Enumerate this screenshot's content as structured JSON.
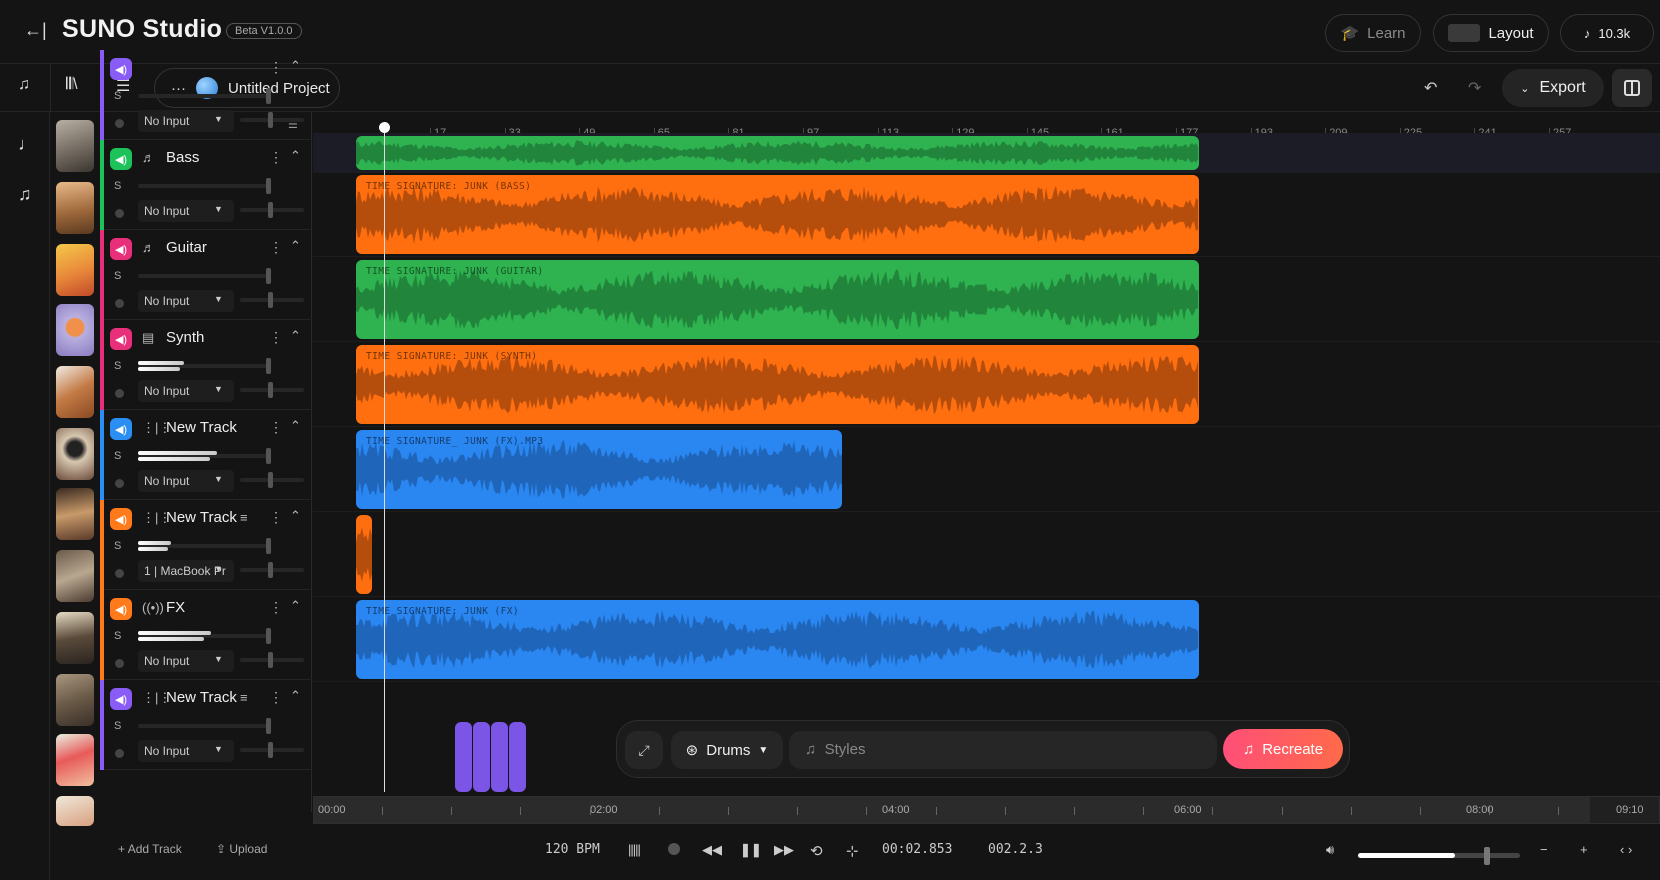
{
  "header": {
    "back_icon": "←|",
    "title": "SUNO Studio",
    "beta": "Beta V1.0.0",
    "learn": "Learn",
    "layout": "Layout",
    "plays": "10.3k"
  },
  "toolbar": {
    "project_name": "Untitled Project",
    "more": "···",
    "export": "Export"
  },
  "tracks": [
    {
      "name": "",
      "input": "No Input",
      "color": "#8a5cf6",
      "mute_color": "#8a5cf6",
      "icon": "",
      "level": 0
    },
    {
      "name": "Bass",
      "input": "No Input",
      "color": "#1ec25a",
      "mute_color": "#1ec25a",
      "icon": "guitar-icon",
      "level": 0
    },
    {
      "name": "Guitar",
      "input": "No Input",
      "color": "#e8307a",
      "mute_color": "#e8307a",
      "icon": "guitar-icon",
      "level": 0
    },
    {
      "name": "Synth",
      "input": "No Input",
      "color": "#e8307a",
      "mute_color": "#e8307a",
      "icon": "keyboard-icon",
      "level": 0.35
    },
    {
      "name": "New Track",
      "input": "No Input",
      "color": "#2a8ef2",
      "mute_color": "#2a8ef2",
      "icon": "waveform-icon",
      "level": 0.6
    },
    {
      "name": "New Track",
      "input": "1 | MacBook Pr",
      "color": "#ff7a1a",
      "mute_color": "#ff7a1a",
      "icon": "waveform-icon",
      "level": 0.25
    },
    {
      "name": "FX",
      "input": "No Input",
      "color": "#ff7a1a",
      "mute_color": "#ff7a1a",
      "icon": "broadcast-icon",
      "level": 0.55
    },
    {
      "name": "New Track",
      "input": "No Input",
      "color": "#8a5cf6",
      "mute_color": "#8a5cf6",
      "icon": "waveform-icon",
      "level": 0
    }
  ],
  "solo_label": "S",
  "ruler_labels": [
    "17",
    "33",
    "49",
    "65",
    "81",
    "97",
    "113",
    "129",
    "145",
    "161",
    "177",
    "193",
    "209",
    "225",
    "241",
    "257"
  ],
  "clips": [
    {
      "label": "",
      "color": "#2fb350"
    },
    {
      "label": "TIME SIGNATURE: JUNK (BASS)",
      "color": "#ff6f0f"
    },
    {
      "label": "TIME SIGNATURE: JUNK (GUITAR)",
      "color": "#2fb350"
    },
    {
      "label": "TIME SIGNATURE: JUNK (SYNTH)",
      "color": "#ff6f0f"
    },
    {
      "label": "TIME SIGNATURE_ JUNK (FX).MP3",
      "color": "#2a86f0"
    },
    {
      "label": "",
      "color": "#ff6f0f"
    },
    {
      "label": "TIME SIGNATURE: JUNK (FX)",
      "color": "#2a86f0"
    }
  ],
  "recreate": {
    "instrument": "Drums",
    "styles_placeholder": "Styles",
    "button": "Recreate"
  },
  "overview": {
    "labels": [
      "00:00",
      "02:00",
      "04:00",
      "06:00",
      "08:00",
      "09:10"
    ]
  },
  "transport": {
    "add_track": "Add Track",
    "upload": "Upload",
    "bpm": "120 BPM",
    "time": "00:02.853",
    "bars": "002.2.3",
    "volume": 0.6
  }
}
